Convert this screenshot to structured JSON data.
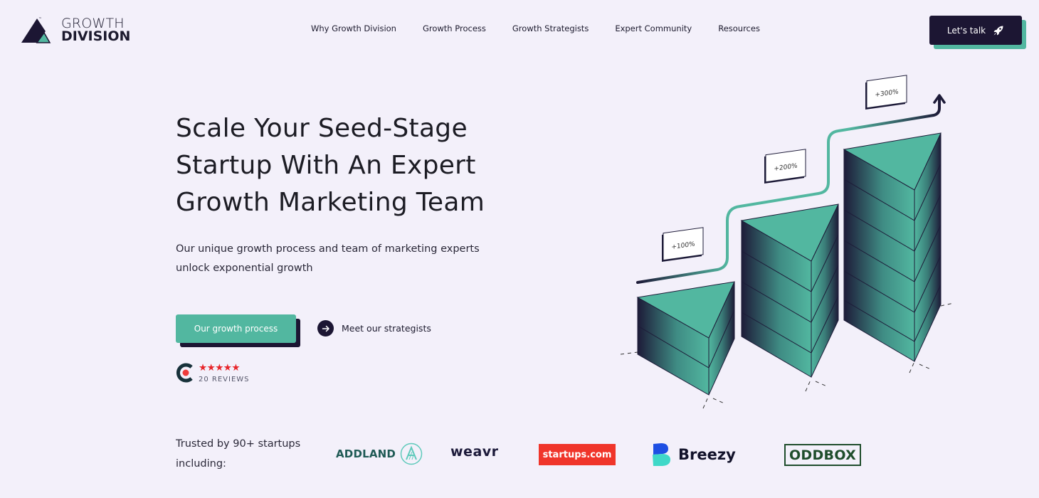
{
  "brand": {
    "name_line1": "GROWTH",
    "name_line2": "DIVISION",
    "accent_color": "#52b7a0",
    "dark_color": "#1c1633"
  },
  "nav": {
    "items": [
      {
        "label": "Why Growth Division"
      },
      {
        "label": "Growth Process"
      },
      {
        "label": "Growth Strategists"
      },
      {
        "label": "Expert Community"
      },
      {
        "label": "Resources"
      }
    ],
    "cta_label": "Let's talk",
    "cta_icon": "rocket-icon"
  },
  "hero": {
    "title_lines": [
      "Scale Your Seed-Stage",
      "Startup With An Expert",
      "Growth Marketing Team"
    ],
    "subtitle_lines": [
      "Our unique growth process and team of marketing experts",
      "unlock exponential growth"
    ],
    "primary_button": "Our growth process",
    "secondary_link": "Meet our strategists",
    "secondary_icon": "arrow-right-icon",
    "rating": {
      "stars": "★★★★★",
      "value": 4.5,
      "reviews_label": "20 REVIEWS",
      "platform_icon": "clutch-logo-icon"
    }
  },
  "illustration": {
    "labels": [
      "+100%",
      "+200%",
      "+300%"
    ]
  },
  "trusted": {
    "line1": "Trusted by 90+ startups",
    "line2": "including:",
    "logos": [
      {
        "name": "ADDLAND"
      },
      {
        "name": "weavr"
      },
      {
        "name": "startups.com"
      },
      {
        "name": "Breezy"
      },
      {
        "name": "ODDBOX"
      }
    ]
  }
}
